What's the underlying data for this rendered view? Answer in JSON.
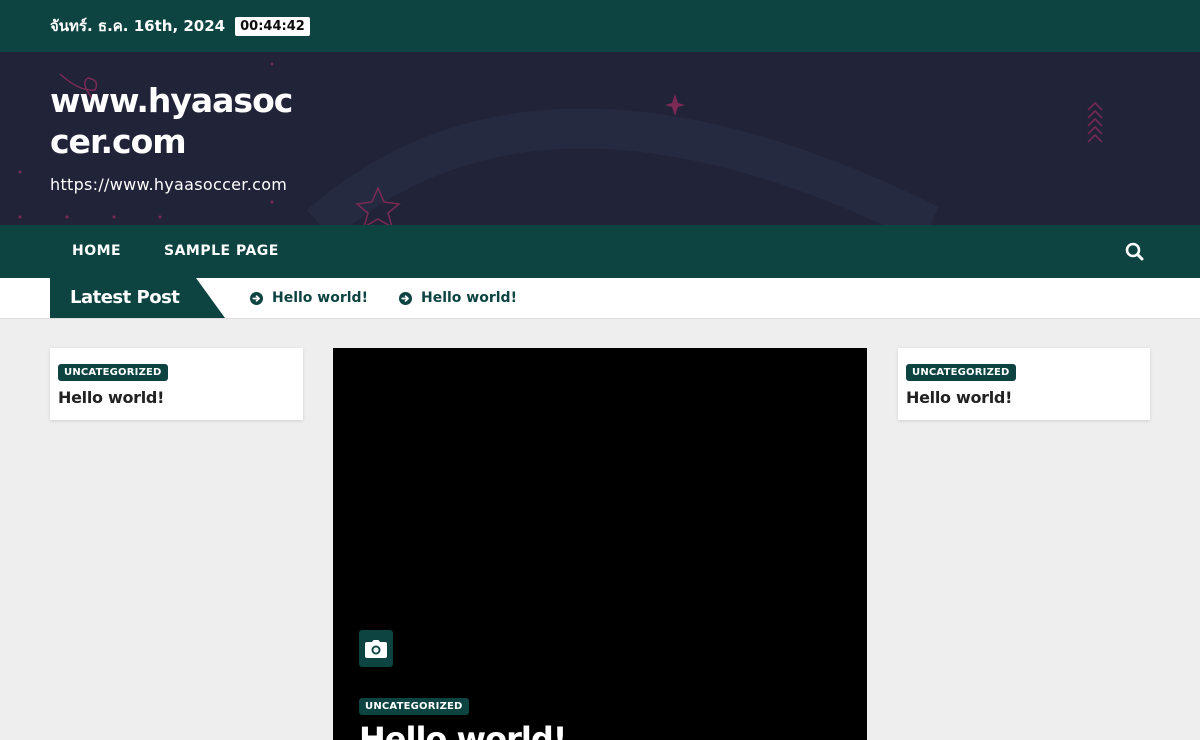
{
  "topbar": {
    "date": "จันทร์. ธ.ค. 16th, 2024",
    "time": "00:44:42"
  },
  "site": {
    "title": "www.hyaasoccer.com",
    "tagline": "https://www.hyaasoccer.com"
  },
  "nav": {
    "items": [
      {
        "label": "HOME"
      },
      {
        "label": "SAMPLE PAGE"
      }
    ],
    "search_icon": "search-icon"
  },
  "ticker": {
    "label": "Latest Post",
    "entries": [
      {
        "label": "Hello world!"
      },
      {
        "label": "Hello world!"
      }
    ]
  },
  "left_card": {
    "category": "UNCATEGORIZED",
    "title": "Hello world!"
  },
  "featured": {
    "category": "UNCATEGORIZED",
    "title": "Hello world!",
    "media_icon": "camera-icon"
  },
  "right_card": {
    "category": "UNCATEGORIZED",
    "title": "Hello world!"
  },
  "colors": {
    "primary": "#0d4442",
    "header_bg": "#212338",
    "page_bg": "#eeeeee",
    "accent_deco": "#7a2a55"
  }
}
